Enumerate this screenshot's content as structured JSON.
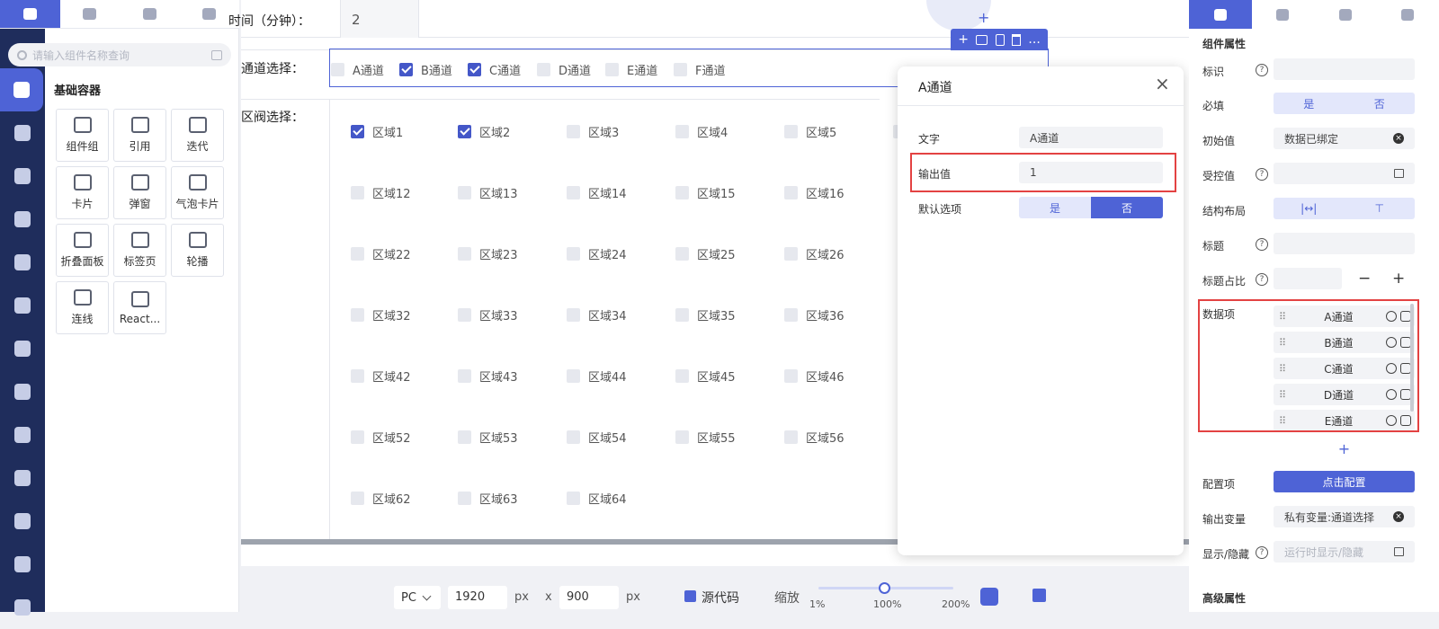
{
  "left_tabs": [
    "puzzle-icon",
    "layers-icon",
    "widgets-icon",
    "user-icon"
  ],
  "rail_icons": [
    "container-icon",
    "apps-icon",
    "chart-icon",
    "pie-icon",
    "clipboard-icon",
    "media-icon",
    "location-icon",
    "video-icon",
    "cube-icon",
    "grid-icon",
    "server-icon",
    "layout-icon",
    "more-icon"
  ],
  "components": {
    "search_placeholder": "请输入组件名称查询",
    "group_title": "基础容器",
    "tiles": [
      "组件组",
      "引用",
      "迭代",
      "卡片",
      "弹窗",
      "气泡卡片",
      "折叠面板",
      "标签页",
      "轮播",
      "连线",
      "React..."
    ]
  },
  "form": {
    "time_label": "时间（分钟）：",
    "time_value": "2",
    "channel_label": "通道选择：",
    "channels": [
      {
        "label": "A通道",
        "checked": false
      },
      {
        "label": "B通道",
        "checked": true
      },
      {
        "label": "C通道",
        "checked": true
      },
      {
        "label": "D通道",
        "checked": false
      },
      {
        "label": "E通道",
        "checked": false
      },
      {
        "label": "F通道",
        "checked": false
      }
    ],
    "valve_label": "区阀选择：",
    "regions": [
      [
        "区域1",
        "区域2",
        "区域3",
        "区域4",
        "区域5",
        "区域"
      ],
      [
        "区域12",
        "区域13",
        "区域14",
        "区域15",
        "区域16"
      ],
      [
        "区域22",
        "区域23",
        "区域24",
        "区域25",
        "区域26"
      ],
      [
        "区域32",
        "区域33",
        "区域34",
        "区域35",
        "区域36"
      ],
      [
        "区域42",
        "区域43",
        "区域44",
        "区域45",
        "区域46"
      ],
      [
        "区域52",
        "区域53",
        "区域54",
        "区域55",
        "区域56"
      ],
      [
        "区域62",
        "区域63",
        "区域64"
      ]
    ],
    "checked_regions": [
      "区域1",
      "区域2"
    ],
    "toolbar_more": "..."
  },
  "popup": {
    "title": "A通道",
    "fields": [
      {
        "label": "文字",
        "value": "A通道"
      },
      {
        "label": "输出值",
        "value": "1"
      }
    ],
    "default_label": "默认选项",
    "default_yes": "是",
    "default_no": "否",
    "default_selected": "否"
  },
  "bottom": {
    "device": "PC",
    "width": "1920",
    "unit1": "px",
    "x": "x",
    "height": "900",
    "unit2": "px",
    "source_code": "源代码",
    "zoom_label": "缩放",
    "zoom_min": "1%",
    "zoom_mid": "100%",
    "zoom_max": "200%"
  },
  "props": {
    "section_title": "组件属性",
    "id_label": "标识",
    "required_label": "必填",
    "required_yes": "是",
    "required_no": "否",
    "initial_label": "初始值",
    "initial_value": "数据已绑定",
    "controlled_label": "受控值",
    "layout_label": "结构布局",
    "title_label": "标题",
    "title_ratio_label": "标题占比",
    "minus": "−",
    "plus": "+",
    "data_items_label": "数据项",
    "data_items": [
      "A通道",
      "B通道",
      "C通道",
      "D通道",
      "E通道"
    ],
    "add": "+",
    "config_label": "配置项",
    "config_button": "点击配置",
    "output_var_label": "输出变量",
    "output_var_value": "私有变量:通道选择",
    "visibility_label": "显示/隐藏",
    "visibility_placeholder": "运行时显示/隐藏",
    "advanced_title": "高级属性"
  },
  "colors": {
    "accent": "#4e63d6",
    "rail": "#1f2d5c",
    "highlight": "#e34242"
  }
}
